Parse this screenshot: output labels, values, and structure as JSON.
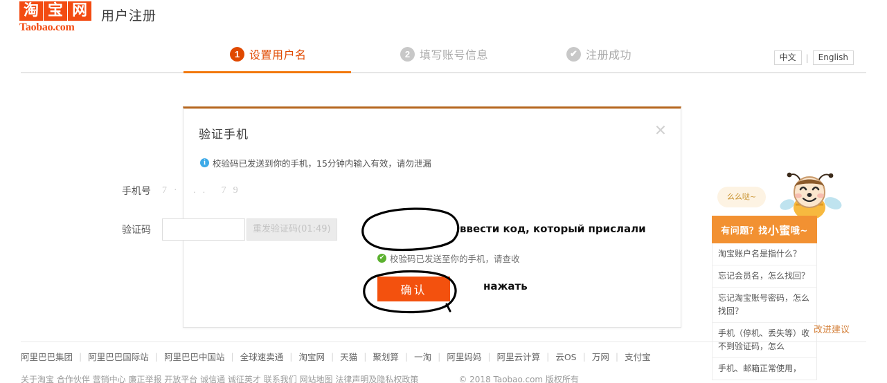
{
  "header": {
    "logo_cn": [
      "淘",
      "宝",
      "网"
    ],
    "logo_en": "Taobao.com",
    "page_title": "用户注册"
  },
  "steps": [
    {
      "badge": "1",
      "label": "设置用户名",
      "state": "active"
    },
    {
      "badge": "2",
      "label": "填写账号信息",
      "state": "inactive"
    },
    {
      "badge": "✔",
      "label": "注册成功",
      "state": "inactive"
    }
  ],
  "language": {
    "chinese": "中文",
    "separator": "|",
    "english": "English"
  },
  "modal": {
    "title": "验证手机",
    "close": "✕",
    "info_icon": "i",
    "info_text": "校验码已发送到你的手机，15分钟内输入有效，请勿泄漏",
    "phone_label": "手机号",
    "phone_value": "7·  ..   79",
    "code_label": "验证码",
    "code_value": "",
    "code_placeholder": "",
    "resend_label": "重发验证码(01:49)",
    "sent_icon": "✔",
    "sent_text": "校验码已发送至你的手机，请查收",
    "confirm_label": "确认"
  },
  "annotations": {
    "code_hint": "ввести код, который прислали",
    "press_hint": "нажать"
  },
  "help": {
    "bubble": "么么哒~",
    "banner_prefix": "有问题？找",
    "banner_highlight": "小蜜",
    "banner_suffix": "哦~",
    "items": [
      "淘宝账户名是指什么？",
      "忘记会员名，怎么找回？",
      "忘记淘宝账号密码，怎么找回？",
      "手机（停机、丢失等）收不到验证码，怎么",
      "手机、邮箱正常使用，"
    ],
    "feedback": "改进建议"
  },
  "footer": {
    "links": [
      "阿里巴巴集团",
      "阿里巴巴国际站",
      "阿里巴巴中国站",
      "全球速卖通",
      "淘宝网",
      "天猫",
      "聚划算",
      "一淘",
      "阿里妈妈",
      "阿里云计算",
      "云OS",
      "万网",
      "支付宝"
    ],
    "copyright_left": "关于淘宝  合作伙伴  营销中心  廉正举报  开放平台  诚信通  诚征英才  联系我们  网站地图  法律声明及隐私权政策",
    "copyright_right": "© 2018 Taobao.com 版权所有"
  },
  "colors": {
    "brand_orange": "#f34b12",
    "step_active": "#e04900",
    "confirm": "#f3510e",
    "modal_top_border": "#b5651d",
    "help_banner": "#f29132"
  }
}
